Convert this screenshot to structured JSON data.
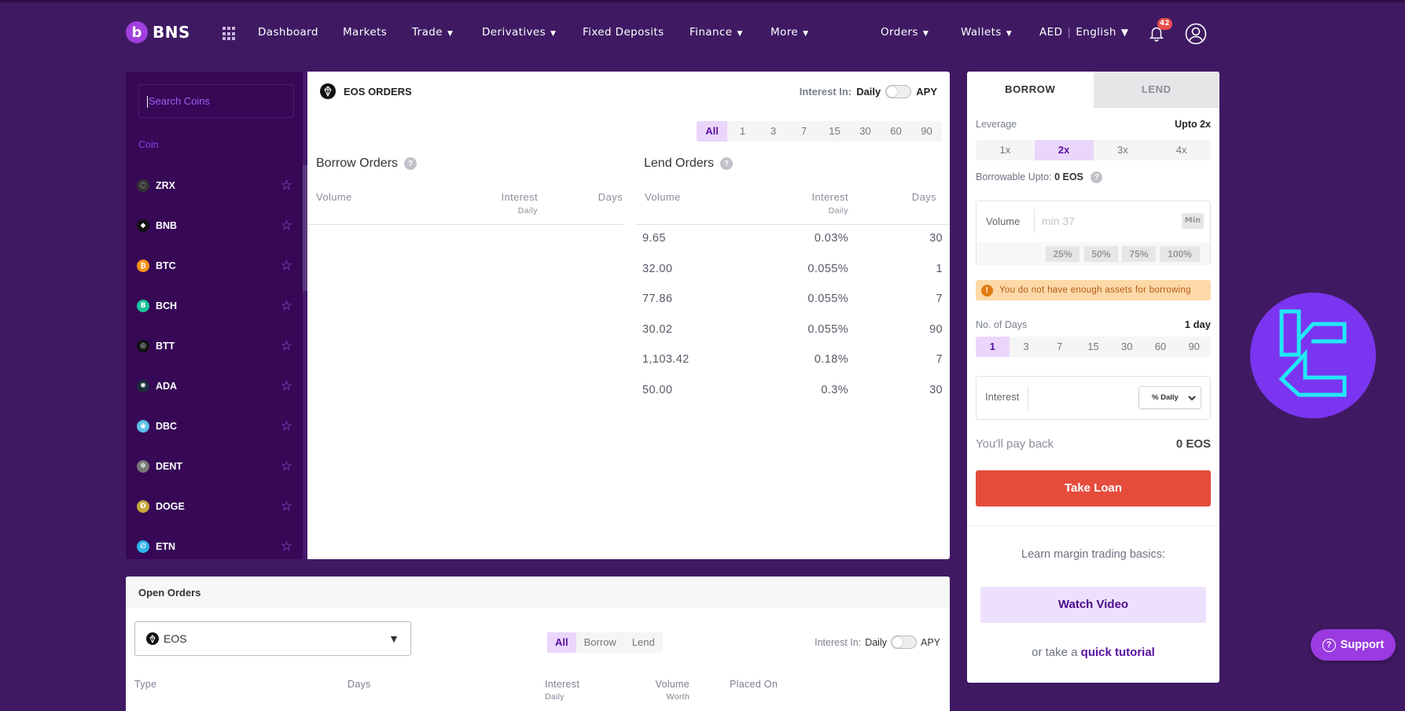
{
  "navbar": {
    "brand": "BNS",
    "brand_badge": "b",
    "items": [
      {
        "label": "Dashboard",
        "dropdown": false
      },
      {
        "label": "Markets",
        "dropdown": false
      },
      {
        "label": "Trade",
        "dropdown": true
      },
      {
        "label": "Derivatives",
        "dropdown": true
      },
      {
        "label": "Fixed Deposits",
        "dropdown": false
      },
      {
        "label": "Finance",
        "dropdown": true
      },
      {
        "label": "More",
        "dropdown": true
      }
    ],
    "right_items": [
      {
        "label": "Orders",
        "dropdown": true
      },
      {
        "label": "Wallets",
        "dropdown": true
      }
    ],
    "currency": "AED",
    "language": "English",
    "notification_count": "42",
    "caret": "▼"
  },
  "sidebar": {
    "search_placeholder": "Search Coins",
    "column_header": "Coin",
    "coins": [
      {
        "symbol": "ZRX",
        "icon": "zrx-icon",
        "color": "#333333",
        "glyph": "◌"
      },
      {
        "symbol": "BNB",
        "icon": "bnb-icon",
        "color": "#111111",
        "glyph": "◆"
      },
      {
        "symbol": "BTC",
        "icon": "btc-icon",
        "color": "#f7931a",
        "glyph": "₿"
      },
      {
        "symbol": "BCH",
        "icon": "bch-icon",
        "color": "#1bc39a",
        "glyph": "B"
      },
      {
        "symbol": "BTT",
        "icon": "btt-icon",
        "color": "#111111",
        "glyph": "◎"
      },
      {
        "symbol": "ADA",
        "icon": "ada-icon",
        "color": "#1c2c3c",
        "glyph": "✺"
      },
      {
        "symbol": "DBC",
        "icon": "dbc-icon",
        "color": "#5bbde4",
        "glyph": "◉"
      },
      {
        "symbol": "DENT",
        "icon": "dent-icon",
        "color": "#777777",
        "glyph": "✻"
      },
      {
        "symbol": "DOGE",
        "icon": "doge-icon",
        "color": "#c9a73a",
        "glyph": "Ð"
      },
      {
        "symbol": "ETN",
        "icon": "etn-icon",
        "color": "#2fb4ea",
        "glyph": "∅"
      }
    ],
    "star_glyph": "☆"
  },
  "orders_panel": {
    "title": "EOS ORDERS",
    "interest_in_label": "Interest In:",
    "interest_daily": "Daily",
    "interest_apy": "APY",
    "apy_enabled": false,
    "day_filters": [
      "All",
      "1",
      "3",
      "7",
      "15",
      "30",
      "60",
      "90"
    ],
    "day_filter_active": "All",
    "borrow": {
      "title": "Borrow Orders",
      "columns": {
        "volume": "Volume",
        "interest": "Interest",
        "interest_sub": "Daily",
        "days": "Days"
      },
      "rows": []
    },
    "lend": {
      "title": "Lend Orders",
      "columns": {
        "volume": "Volume",
        "interest": "Interest",
        "interest_sub": "Daily",
        "days": "Days"
      },
      "rows": [
        {
          "volume": "9.65",
          "interest": "0.03%",
          "days": "30"
        },
        {
          "volume": "32.00",
          "interest": "0.055%",
          "days": "1"
        },
        {
          "volume": "77.86",
          "interest": "0.055%",
          "days": "7"
        },
        {
          "volume": "30.02",
          "interest": "0.055%",
          "days": "90"
        },
        {
          "volume": "1,103.42",
          "interest": "0.18%",
          "days": "7"
        },
        {
          "volume": "50.00",
          "interest": "0.3%",
          "days": "30"
        }
      ]
    },
    "help_glyph": "?"
  },
  "loan_panel": {
    "tabs": [
      "BORROW",
      "LEND"
    ],
    "active_tab": "BORROW",
    "leverage_label": "Leverage",
    "leverage_max": "Upto 2x",
    "leverage_options": [
      "1x",
      "2x",
      "3x",
      "4x"
    ],
    "leverage_active": "2x",
    "borrowable_label": "Borrowable Upto:",
    "borrowable_value": "0 EOS",
    "volume_label": "Volume",
    "volume_placeholder": "min 37",
    "min_button": "Min",
    "percent_options": [
      "25%",
      "50%",
      "75%",
      "100%"
    ],
    "warning": "You do not have enough assets for borrowing",
    "days_label": "No. of Days",
    "days_value": "1 day",
    "days_options": [
      "1",
      "3",
      "7",
      "15",
      "30",
      "60",
      "90"
    ],
    "days_active": "1",
    "interest_label": "Interest",
    "interest_unit": "% Daily",
    "payback_label": "You'll pay back",
    "payback_value": "0 EOS",
    "take_loan": "Take Loan",
    "learn_text": "Learn margin trading basics:",
    "watch_video": "Watch Video",
    "tutorial_prefix": "or take a",
    "tutorial_link": "quick tutorial"
  },
  "open_orders": {
    "title": "Open Orders",
    "coin_selected": "EOS",
    "type_filters": [
      "All",
      "Borrow",
      "Lend"
    ],
    "type_active": "All",
    "interest_in_label": "Interest In:",
    "interest_daily": "Daily",
    "interest_apy": "APY",
    "columns": [
      {
        "label": "Type",
        "sub": ""
      },
      {
        "label": "Days",
        "sub": ""
      },
      {
        "label": "Interest",
        "sub": "Daily"
      },
      {
        "label": "Volume",
        "sub": "Worth"
      },
      {
        "label": "Placed On",
        "sub": ""
      }
    ]
  },
  "support": {
    "label": "Support",
    "glyph": "?"
  },
  "colors": {
    "background": "#3f1a63",
    "sidebar": "#360856",
    "accent": "#5a0fa0",
    "accent_light": "#ead6fb",
    "danger": "#e54c3c",
    "warning_bg": "#fdd9a8"
  }
}
